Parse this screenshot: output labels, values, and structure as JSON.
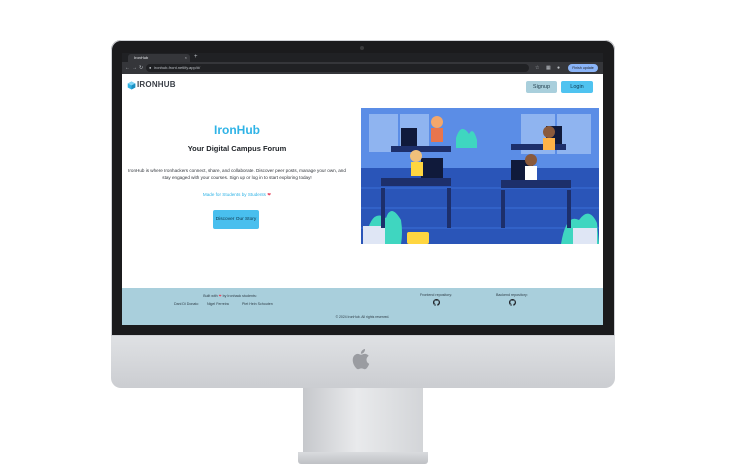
{
  "browser": {
    "tab_title": "IronHub",
    "tab_close": "×",
    "tab_new": "+",
    "url": "ironhub-front.netlify.app/#/",
    "update_label": "Finish update",
    "nav": {
      "back": "←",
      "forward": "→",
      "reload": "↻"
    }
  },
  "header": {
    "logo_text": "IRONHUB",
    "signup_label": "Signup",
    "login_label": "Login"
  },
  "hero": {
    "title": "IronHub",
    "subtitle": "Your Digital Campus Forum",
    "description": "IronHub is where Ironhackers connect, share, and collaborate. Discover peer posts, manage your own, and stay engaged with your courses. Sign up or log in to start exploring today!",
    "made_for": "Made for Students by Students",
    "heart": "❤",
    "cta_label": "Discover Our Story"
  },
  "footer": {
    "built_with_prefix": "Built with",
    "built_with_suffix": "by Ironhack students:",
    "developers": [
      "Dani Di Donato",
      "Nigel Ferreira",
      "Piet Hein Schouten"
    ],
    "frontend_repo_label": "Frontend repository:",
    "backend_repo_label": "Backend repository:",
    "copyright": "© 2024 IronHub. All rights reserved."
  },
  "icons": {
    "logo": "cube-logo-icon",
    "repo": "github-icon",
    "device": "apple-logo-icon"
  },
  "colors": {
    "accent": "#2fb3e6",
    "login_bg": "#4fc3f0",
    "signup_bg": "#a9cfdc",
    "footer_bg": "#a9cfdc",
    "illustration_bg": "#3b6fd8"
  }
}
